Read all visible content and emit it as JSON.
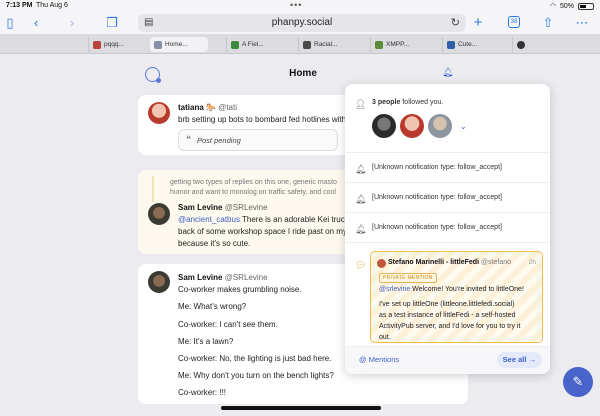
{
  "status_bar": {
    "time": "7:13 PM",
    "date": "Thu Aug 6",
    "battery": "50%",
    "battery_level": 0.5
  },
  "browser": {
    "host": "phanpy.social",
    "tab_count": "38",
    "tabs": [
      {
        "label": "pqqq...",
        "color": "#b8413a"
      },
      {
        "label": "Home...",
        "color": "#8a8fa8"
      },
      {
        "label": "A Fiel...",
        "color": "#3b8a3e"
      },
      {
        "label": "Racial...",
        "color": "#4a4a4a"
      },
      {
        "label": "XMPP...",
        "color": "#5a8c3a"
      },
      {
        "label": "Cute...",
        "color": "#2f5fa8"
      },
      {
        "label": "",
        "color": "#333"
      }
    ]
  },
  "column": {
    "title": "Home"
  },
  "posts": [
    {
      "name": "tatiana 🐎",
      "handle": "@tati",
      "lines": [
        "brb setting up bots to bombard fed hotlines with"
      ],
      "pending": "Post pending"
    },
    {
      "context": [
        "getting two types of replies on this one, generic masto",
        "humor and want to monolog on traffic safety, and cool"
      ],
      "name": "Sam Levine",
      "handle": "@SRLevine",
      "mention": "@ancient_catbus",
      "lines": [
        "There is an adorable Kei truck",
        "back of some workshop space I ride past on my",
        "because it's so cute."
      ]
    },
    {
      "name": "Sam Levine",
      "handle": "@SRLevine",
      "lines": [
        "Co-worker makes grumbling noise.",
        "Me: What's wrong?",
        "Co-worker: I can't see them.",
        "Me: It's a lawn?",
        "Co-worker: No, the lighting is just bad here.",
        "Me: Why don't you turn on the bench lights?",
        "Co-worker: !!!"
      ]
    }
  ],
  "notifications": {
    "follow": {
      "count_text": "3 people",
      "rest": " followed you."
    },
    "unknown": [
      "[Unknown notification type: follow_accept]",
      "[Unknown notification type: follow_accept]",
      "[Unknown notification type: follow_accept]"
    ],
    "mention": {
      "name": "Stefano Marinelli - littleFedi",
      "handle": "@stefano",
      "time": "2h",
      "badge": "PRIVATE MENTION",
      "mention": "@srlevine",
      "first_line_rest": " Welcome! You're invited to littleOne!",
      "lines": [
        "I've set up littleOne (littleone.littlefedi.social)",
        "as a test instance of littleFedi - a self-hosted",
        "ActivityPub server, and I'd love for you to try it",
        "out."
      ]
    },
    "footer": {
      "mentions": "Mentions",
      "see_all": "See all →"
    }
  }
}
